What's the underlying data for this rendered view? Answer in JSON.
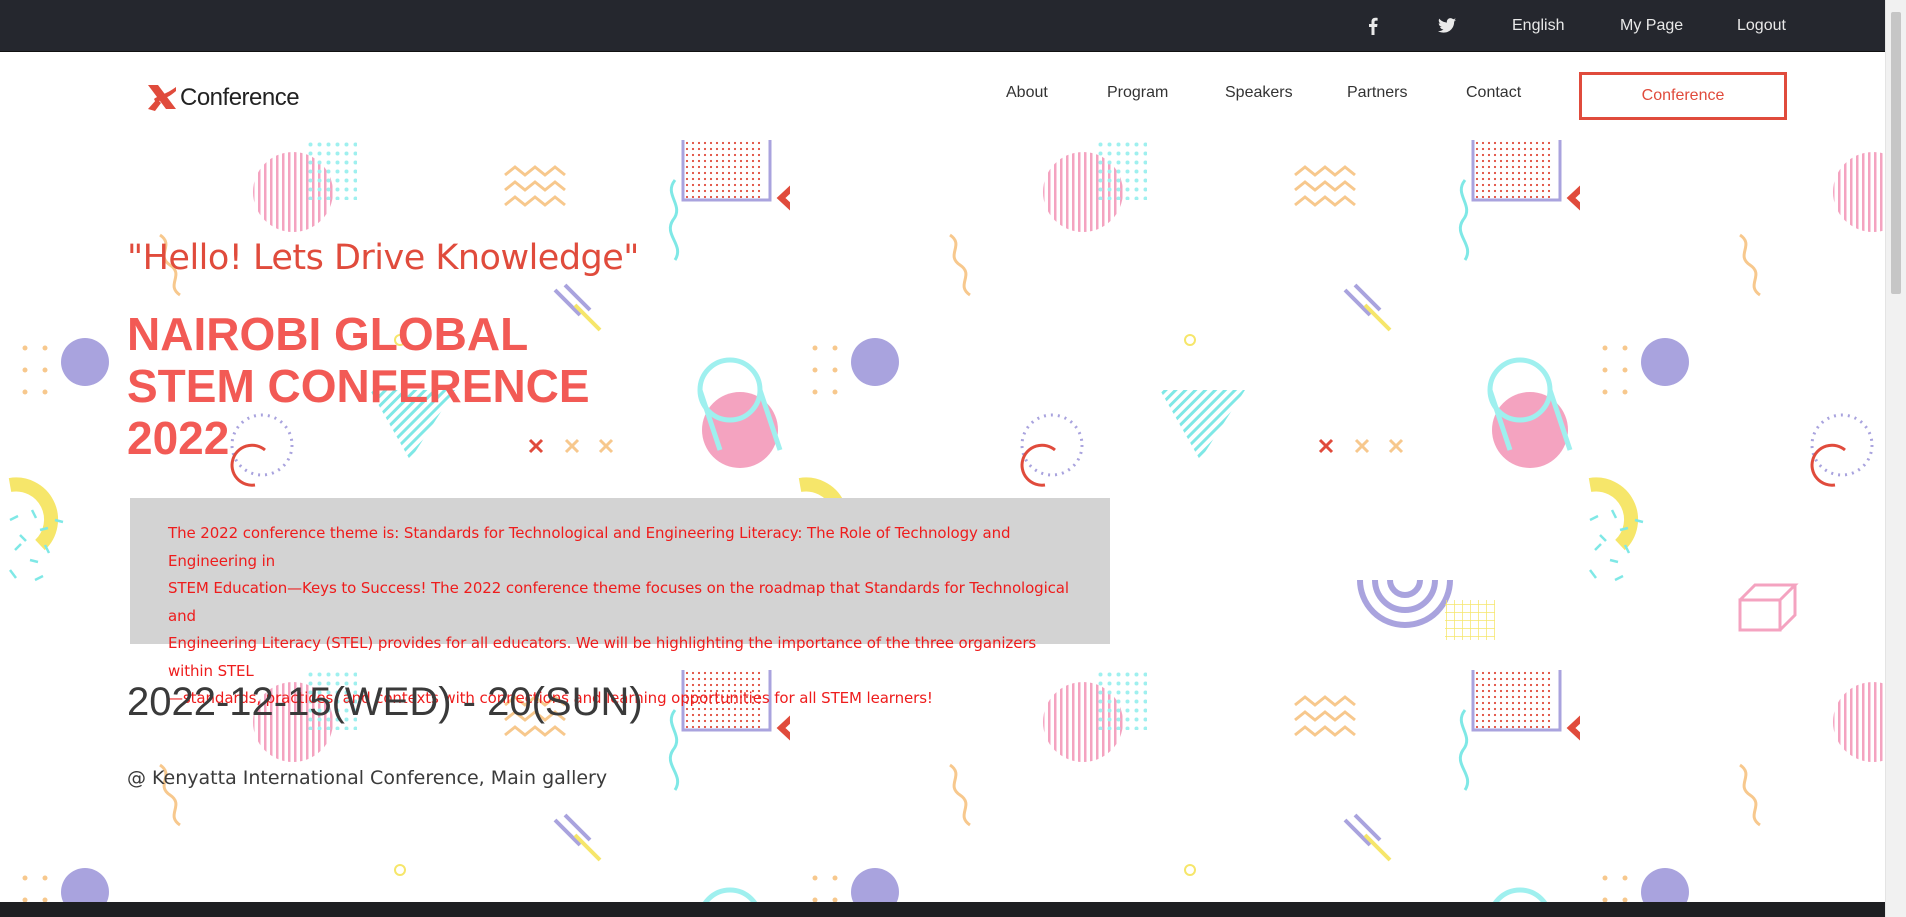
{
  "topbar": {
    "facebook_icon": "facebook-icon",
    "twitter_icon": "twitter-icon",
    "language": "English",
    "mypage": "My Page",
    "logout": "Logout"
  },
  "navbar": {
    "logo_text": "Conference",
    "links": [
      "About",
      "Program",
      "Speakers",
      "Partners",
      "Contact"
    ],
    "cta": "Conference"
  },
  "hero": {
    "tagline": "\"Hello! Lets Drive Knowledge\"",
    "title_line1": "NAIROBI GLOBAL",
    "title_line2": "STEM CONFERENCE",
    "title_line3": "2022",
    "theme_line1": "The 2022 conference theme is: Standards for Technological and Engineering Literacy: The Role of Technology and Engineering in",
    "theme_line2": "STEM Education—Keys to Success! The 2022 conference theme focuses on the roadmap that Standards for Technological and",
    "theme_line3": "Engineering Literacy (STEL) provides for all educators. We will be highlighting the importance of the three organizers within STEL",
    "theme_line4": "—standards, practices, and contexts with connections and learning opportunities for all STEM learners!",
    "date": "2022-12-15(WED) - 20(SUN)",
    "venue": "@ Kenyatta International Conference, Main gallery"
  },
  "colors": {
    "topbar_bg": "#25272e",
    "accent": "#e04b3c",
    "title_red": "#f25a55",
    "theme_box_bg": "#d3d3d3",
    "theme_text": "#ee1c1c"
  }
}
